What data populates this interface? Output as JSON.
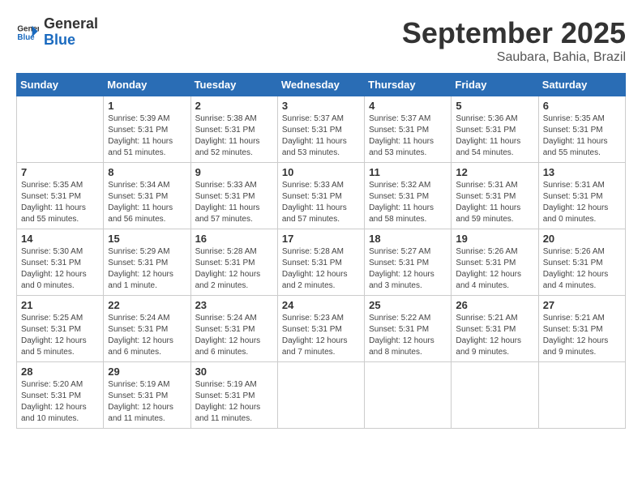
{
  "header": {
    "logo_line1": "General",
    "logo_line2": "Blue",
    "month": "September 2025",
    "location": "Saubara, Bahia, Brazil"
  },
  "weekdays": [
    "Sunday",
    "Monday",
    "Tuesday",
    "Wednesday",
    "Thursday",
    "Friday",
    "Saturday"
  ],
  "weeks": [
    [
      {
        "day": "",
        "info": ""
      },
      {
        "day": "1",
        "info": "Sunrise: 5:39 AM\nSunset: 5:31 PM\nDaylight: 11 hours\nand 51 minutes."
      },
      {
        "day": "2",
        "info": "Sunrise: 5:38 AM\nSunset: 5:31 PM\nDaylight: 11 hours\nand 52 minutes."
      },
      {
        "day": "3",
        "info": "Sunrise: 5:37 AM\nSunset: 5:31 PM\nDaylight: 11 hours\nand 53 minutes."
      },
      {
        "day": "4",
        "info": "Sunrise: 5:37 AM\nSunset: 5:31 PM\nDaylight: 11 hours\nand 53 minutes."
      },
      {
        "day": "5",
        "info": "Sunrise: 5:36 AM\nSunset: 5:31 PM\nDaylight: 11 hours\nand 54 minutes."
      },
      {
        "day": "6",
        "info": "Sunrise: 5:35 AM\nSunset: 5:31 PM\nDaylight: 11 hours\nand 55 minutes."
      }
    ],
    [
      {
        "day": "7",
        "info": "Sunrise: 5:35 AM\nSunset: 5:31 PM\nDaylight: 11 hours\nand 55 minutes."
      },
      {
        "day": "8",
        "info": "Sunrise: 5:34 AM\nSunset: 5:31 PM\nDaylight: 11 hours\nand 56 minutes."
      },
      {
        "day": "9",
        "info": "Sunrise: 5:33 AM\nSunset: 5:31 PM\nDaylight: 11 hours\nand 57 minutes."
      },
      {
        "day": "10",
        "info": "Sunrise: 5:33 AM\nSunset: 5:31 PM\nDaylight: 11 hours\nand 57 minutes."
      },
      {
        "day": "11",
        "info": "Sunrise: 5:32 AM\nSunset: 5:31 PM\nDaylight: 11 hours\nand 58 minutes."
      },
      {
        "day": "12",
        "info": "Sunrise: 5:31 AM\nSunset: 5:31 PM\nDaylight: 11 hours\nand 59 minutes."
      },
      {
        "day": "13",
        "info": "Sunrise: 5:31 AM\nSunset: 5:31 PM\nDaylight: 12 hours\nand 0 minutes."
      }
    ],
    [
      {
        "day": "14",
        "info": "Sunrise: 5:30 AM\nSunset: 5:31 PM\nDaylight: 12 hours\nand 0 minutes."
      },
      {
        "day": "15",
        "info": "Sunrise: 5:29 AM\nSunset: 5:31 PM\nDaylight: 12 hours\nand 1 minute."
      },
      {
        "day": "16",
        "info": "Sunrise: 5:28 AM\nSunset: 5:31 PM\nDaylight: 12 hours\nand 2 minutes."
      },
      {
        "day": "17",
        "info": "Sunrise: 5:28 AM\nSunset: 5:31 PM\nDaylight: 12 hours\nand 2 minutes."
      },
      {
        "day": "18",
        "info": "Sunrise: 5:27 AM\nSunset: 5:31 PM\nDaylight: 12 hours\nand 3 minutes."
      },
      {
        "day": "19",
        "info": "Sunrise: 5:26 AM\nSunset: 5:31 PM\nDaylight: 12 hours\nand 4 minutes."
      },
      {
        "day": "20",
        "info": "Sunrise: 5:26 AM\nSunset: 5:31 PM\nDaylight: 12 hours\nand 4 minutes."
      }
    ],
    [
      {
        "day": "21",
        "info": "Sunrise: 5:25 AM\nSunset: 5:31 PM\nDaylight: 12 hours\nand 5 minutes."
      },
      {
        "day": "22",
        "info": "Sunrise: 5:24 AM\nSunset: 5:31 PM\nDaylight: 12 hours\nand 6 minutes."
      },
      {
        "day": "23",
        "info": "Sunrise: 5:24 AM\nSunset: 5:31 PM\nDaylight: 12 hours\nand 6 minutes."
      },
      {
        "day": "24",
        "info": "Sunrise: 5:23 AM\nSunset: 5:31 PM\nDaylight: 12 hours\nand 7 minutes."
      },
      {
        "day": "25",
        "info": "Sunrise: 5:22 AM\nSunset: 5:31 PM\nDaylight: 12 hours\nand 8 minutes."
      },
      {
        "day": "26",
        "info": "Sunrise: 5:21 AM\nSunset: 5:31 PM\nDaylight: 12 hours\nand 9 minutes."
      },
      {
        "day": "27",
        "info": "Sunrise: 5:21 AM\nSunset: 5:31 PM\nDaylight: 12 hours\nand 9 minutes."
      }
    ],
    [
      {
        "day": "28",
        "info": "Sunrise: 5:20 AM\nSunset: 5:31 PM\nDaylight: 12 hours\nand 10 minutes."
      },
      {
        "day": "29",
        "info": "Sunrise: 5:19 AM\nSunset: 5:31 PM\nDaylight: 12 hours\nand 11 minutes."
      },
      {
        "day": "30",
        "info": "Sunrise: 5:19 AM\nSunset: 5:31 PM\nDaylight: 12 hours\nand 11 minutes."
      },
      {
        "day": "",
        "info": ""
      },
      {
        "day": "",
        "info": ""
      },
      {
        "day": "",
        "info": ""
      },
      {
        "day": "",
        "info": ""
      }
    ]
  ]
}
